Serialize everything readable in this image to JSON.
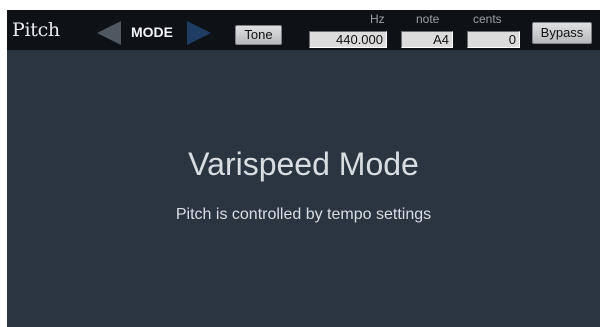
{
  "toolbar": {
    "title": "Pitch",
    "mode_label": "MODE",
    "tone_label": "Tone",
    "bypass_label": "Bypass",
    "fields": {
      "hz": {
        "label": "Hz",
        "value": "440.000"
      },
      "note": {
        "label": "note",
        "value": "A4"
      },
      "cents": {
        "label": "cents",
        "value": "0"
      }
    }
  },
  "main": {
    "heading": "Varispeed Mode",
    "description": "Pitch is controlled by tempo settings"
  },
  "colors": {
    "panel_background": "#2b3541",
    "toolbar_background": "#0e1116",
    "left_arrow": "#4f5761",
    "right_arrow": "#1d3d63",
    "text": "#d9dde2"
  },
  "icons": {
    "prev_mode": "triangle-left-icon",
    "next_mode": "triangle-right-icon"
  }
}
